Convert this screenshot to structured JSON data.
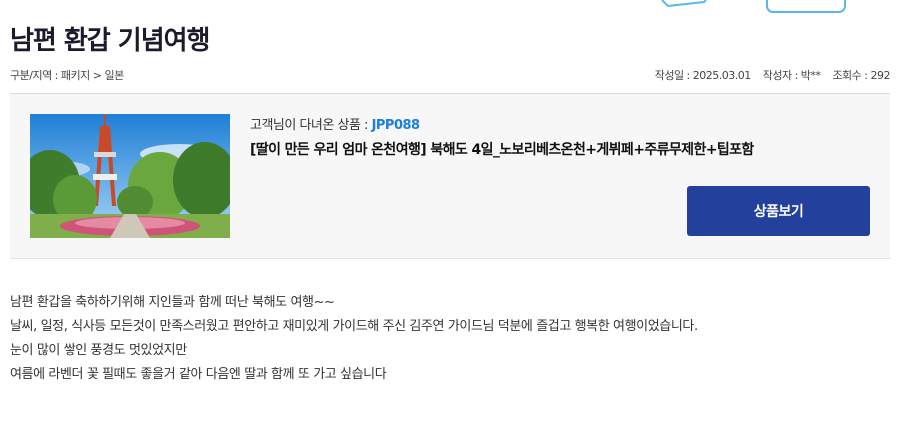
{
  "post": {
    "title": "남편 환갑 기념여행",
    "category": "구분/지역 : 패키지 > 일본",
    "date": "작성일 : 2025.03.01",
    "author": "작성자 : 박**",
    "views": "조회수 : 292"
  },
  "product": {
    "intro_label": "고객님이 다녀온 상품 : ",
    "code": "JPP088",
    "name": "[딸이 만든 우리 엄마 온천여행] 북해도 4일_노보리베츠온천+게뷔페+주류무제한+팁포함",
    "view_button": "상품보기",
    "code_color": "#1a7fe0",
    "button_color": "#23409c"
  },
  "review": {
    "lines": [
      "남편 환갑을 축하하기위해 지인들과 함께 떠난 북해도 여행~~",
      "날씨, 일정, 식사등 모든것이 만족스러웠고 편안하고 재미있게 가이드해 주신 김주연 가이드님 덕분에 즐겁고 행복한 여행이었습니다.",
      "눈이 많이 쌓인 풍경도 멋있었지만",
      "여름에 라벤더 꽃 필때도 좋을거 같아 다음엔 딸과 함께 또 가고 싶습니다"
    ]
  }
}
